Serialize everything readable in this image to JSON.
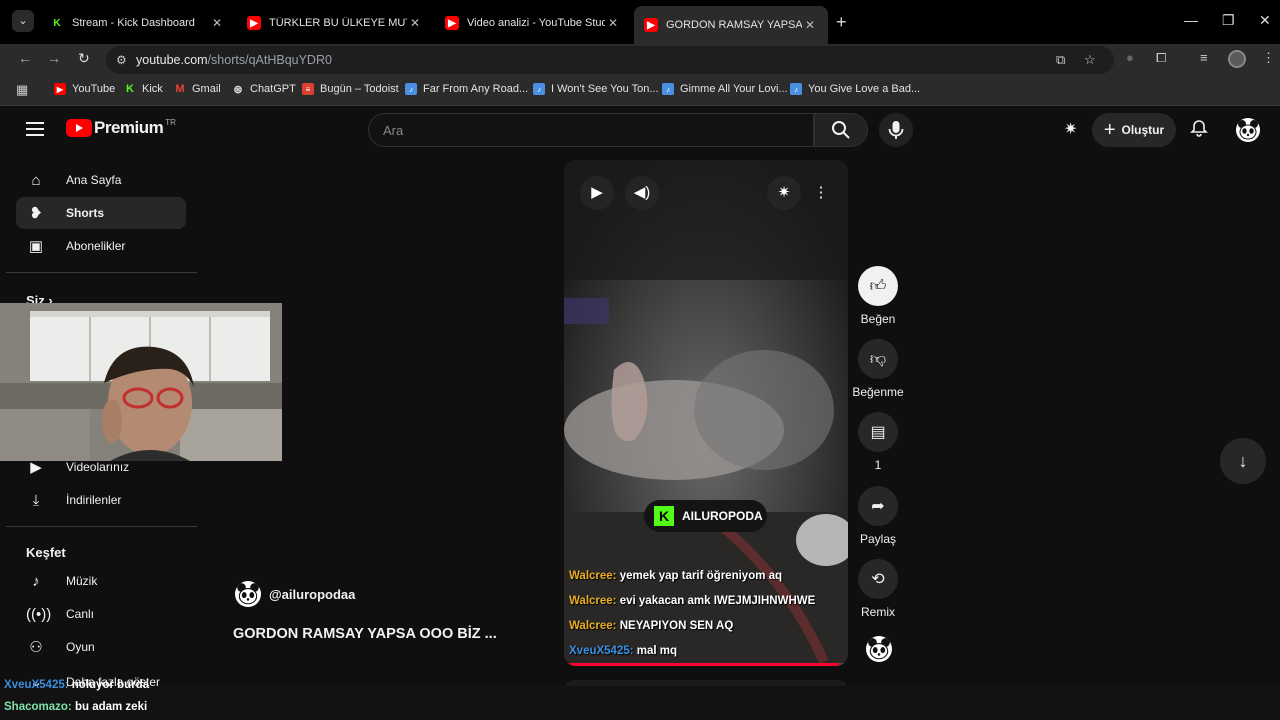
{
  "browser": {
    "tabs": [
      {
        "title": "Stream - Kick Dashboard",
        "favicon": "kick-icon"
      },
      {
        "title": "TÜRKLER BU ÜLKEYE MUTLAKA",
        "favicon": "youtube-icon"
      },
      {
        "title": "Video analizi - YouTube Studio",
        "favicon": "youtube-icon"
      },
      {
        "title": "GORDON RAMSAY YAPSA OOO",
        "favicon": "youtube-icon",
        "active": true
      }
    ],
    "url_host": "youtube.com",
    "url_path": "/shorts/qAtHBquYDR0",
    "bookmarks": [
      {
        "label": "YouTube"
      },
      {
        "label": "Kick"
      },
      {
        "label": "Gmail"
      },
      {
        "label": "ChatGPT"
      },
      {
        "label": "Bugün – Todoist"
      },
      {
        "label": "Far From Any Road..."
      },
      {
        "label": "I Won't See You Ton..."
      },
      {
        "label": "Gimme All Your Lovi..."
      },
      {
        "label": "You Give Love a Bad..."
      }
    ]
  },
  "header": {
    "brand": "Premium",
    "country": "TR",
    "search_placeholder": "Ara",
    "create_label": "Oluştur"
  },
  "sidebar": {
    "main": [
      {
        "label": "Ana Sayfa",
        "icon": "home-icon"
      },
      {
        "label": "Shorts",
        "icon": "shorts-icon",
        "active": true
      },
      {
        "label": "Abonelikler",
        "icon": "subscriptions-icon"
      }
    ],
    "you_heading": "Siz",
    "you_items": [
      {
        "label": "Videolarınız",
        "icon": "your-videos-icon"
      },
      {
        "label": "İndirilenler",
        "icon": "download-icon"
      }
    ],
    "explore_heading": "Keşfet",
    "explore_items": [
      {
        "label": "Müzik",
        "icon": "music-icon"
      },
      {
        "label": "Canlı",
        "icon": "live-icon"
      },
      {
        "label": "Oyun",
        "icon": "gaming-icon"
      }
    ],
    "show_more": "Daha fazla göster"
  },
  "player": {
    "stream_badge": "AILUROPODA",
    "chat": [
      {
        "user": "Walcree:",
        "msg": "yemek yap tarif öğreniyom aq"
      },
      {
        "user": "Walcree:",
        "msg": "evi yakacan amk IWEJMJIHNWHWE"
      },
      {
        "user": "Walcree:",
        "msg": "NEYAPIYON SEN AQ"
      },
      {
        "user": "XveuX5425:",
        "msg": "mal mq"
      }
    ],
    "progress": 0.97
  },
  "actions": {
    "like": "Beğen",
    "dislike": "Beğenme",
    "comments": "1",
    "share": "Paylaş",
    "remix": "Remix"
  },
  "channel": {
    "handle": "@ailuropodaa",
    "title": "GORDON RAMSAY YAPSA OOO BİZ ..."
  },
  "stream_chat": [
    {
      "user": "XveuX5425:",
      "msg": "noluyor burda"
    },
    {
      "user": "Shacomazo:",
      "msg": "bu adam zeki"
    }
  ]
}
